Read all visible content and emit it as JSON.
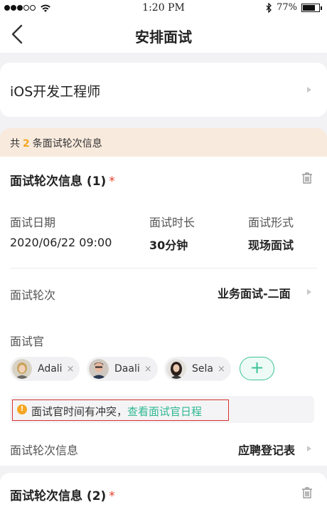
{
  "status_bar": {
    "time": "1:20 PM",
    "battery": "77%",
    "battery_level": 0.77
  },
  "nav": {
    "title": "安排面试",
    "back_icon": "chevron-left-icon"
  },
  "job": {
    "title": "iOS开发工程师"
  },
  "banner": {
    "prefix": "共",
    "count": "2",
    "suffix": "条面试轮次信息"
  },
  "round1": {
    "title": "面试轮次信息 (1)",
    "required_mark": "*",
    "date_label": "面试日期",
    "date_value": "2020/06/22 09:00",
    "duration_label": "面试时长",
    "duration_value": "30分钟",
    "format_label": "面试形式",
    "format_value": "现场面试",
    "round_label": "面试轮次",
    "round_value": "业务面试-二面",
    "interviewer_label": "面试官",
    "interviewers": [
      {
        "name": "Adali",
        "remove": "×"
      },
      {
        "name": "Daali",
        "remove": "×"
      },
      {
        "name": "Sela",
        "remove": "×"
      }
    ],
    "add_label": "+",
    "warning_text": "面试官时间有冲突，",
    "warning_link": "查看面试官日程",
    "warning_icon_glyph": "!",
    "info_label": "面试轮次信息",
    "info_value": "应聘登记表"
  },
  "round2": {
    "title": "面试轮次信息 (2)",
    "required_mark": "*"
  },
  "colors": {
    "accent_green": "#3cc39a",
    "warning_orange": "#f5a623",
    "required_red": "#e8412f",
    "banner_bg": "#f8eadd"
  }
}
